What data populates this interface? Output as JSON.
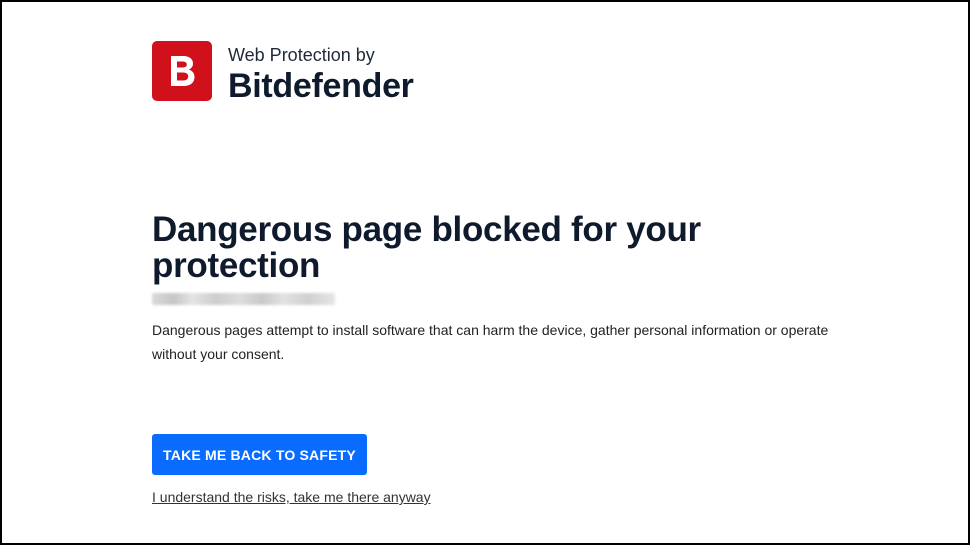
{
  "brand": {
    "subtitle": "Web Protection by",
    "name": "Bitdefender",
    "logo_letter": "B",
    "logo_icon": "bitdefender-logo-icon",
    "logo_color": "#d0111b"
  },
  "warning": {
    "headline": "Dangerous page blocked for your protection",
    "description": "Dangerous pages attempt to install software that can harm the device, gather personal information or operate without your consent."
  },
  "actions": {
    "safety_button_label": "TAKE ME BACK TO SAFETY",
    "safety_button_color": "#0a6cff",
    "proceed_link_label": "I understand the risks, take me there anyway"
  }
}
